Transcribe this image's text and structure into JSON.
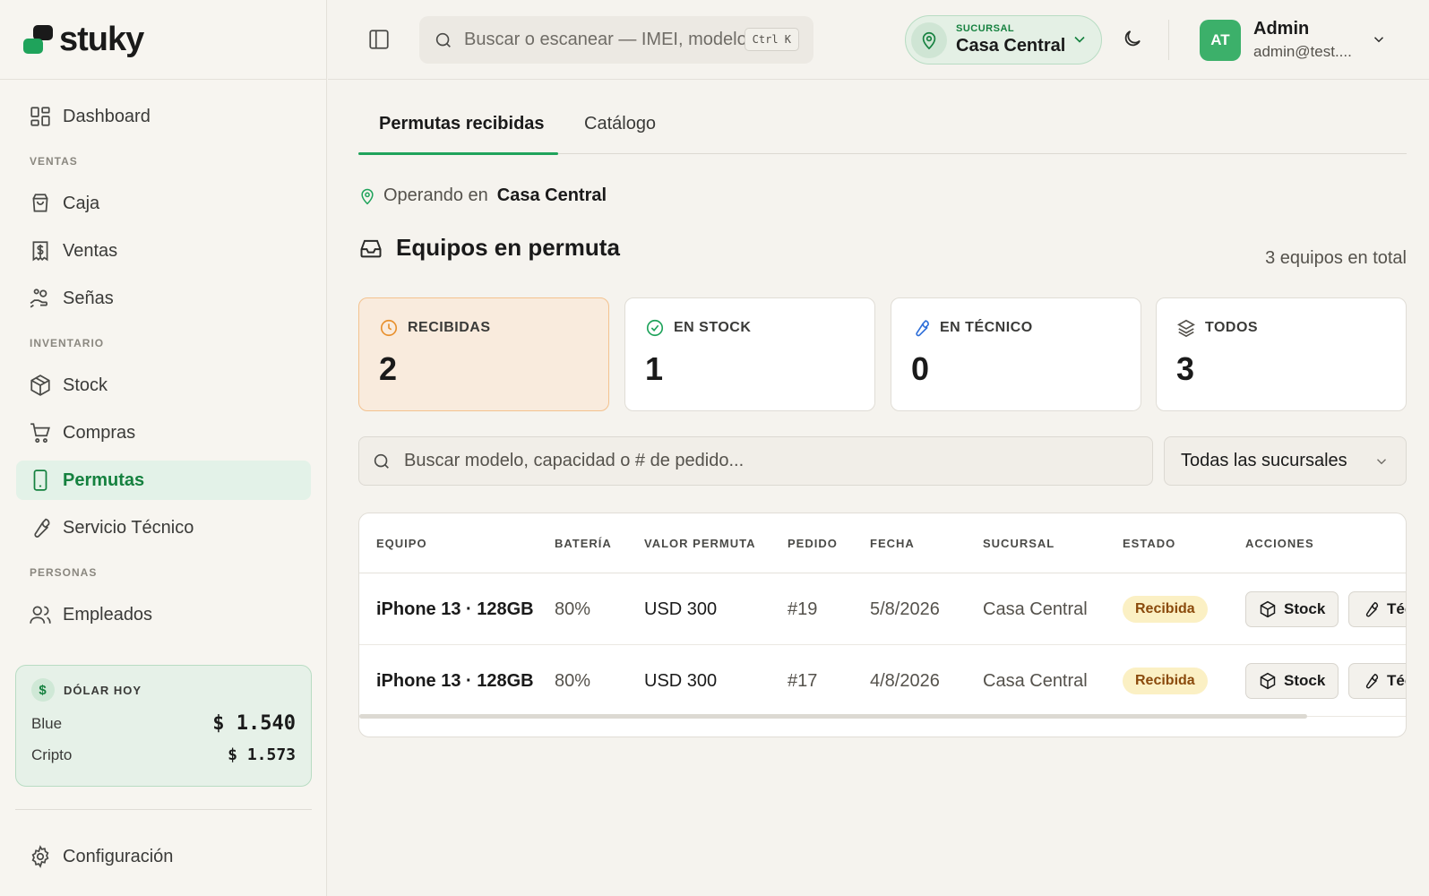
{
  "brand": {
    "name": "stuky"
  },
  "sidebar": {
    "items": [
      {
        "label": "Dashboard",
        "icon": "dashboard-icon"
      },
      {
        "section": "VENTAS"
      },
      {
        "label": "Caja",
        "icon": "shopping-bag-icon"
      },
      {
        "label": "Ventas",
        "icon": "receipt-dollar-icon"
      },
      {
        "label": "Señas",
        "icon": "hand-coins-icon"
      },
      {
        "section": "INVENTARIO"
      },
      {
        "label": "Stock",
        "icon": "package-icon"
      },
      {
        "label": "Compras",
        "icon": "cart-icon"
      },
      {
        "label": "Permutas",
        "icon": "smartphone-icon",
        "active": true
      },
      {
        "label": "Servicio Técnico",
        "icon": "wrench-icon"
      },
      {
        "section": "PERSONAS"
      },
      {
        "label": "Empleados",
        "icon": "users-icon"
      }
    ],
    "dolar": {
      "title": "DÓLAR HOY",
      "rows": [
        {
          "label": "Blue",
          "value": "$ 1.540"
        },
        {
          "label": "Cripto",
          "value": "$ 1.573"
        }
      ]
    },
    "config_label": "Configuración"
  },
  "header": {
    "search_placeholder": "Buscar o escanear — IMEI, modelo, # de pedido",
    "shortcut": "Ctrl K",
    "sucursal_label": "SUCURSAL",
    "sucursal_value": "Casa Central",
    "user": {
      "initials": "AT",
      "name": "Admin",
      "email": "admin@test...."
    }
  },
  "main": {
    "tabs": [
      {
        "label": "Permutas recibidas",
        "active": true
      },
      {
        "label": "Catálogo"
      }
    ],
    "operando_prefix": "Operando en",
    "operando_value": "Casa Central",
    "section_title": "Equipos en permuta",
    "total_text": "3 equipos en total",
    "cards": [
      {
        "label": "RECIBIDAS",
        "value": "2",
        "icon": "clock-icon",
        "color": "#e8912f"
      },
      {
        "label": "EN STOCK",
        "value": "1",
        "icon": "check-circle-icon",
        "color": "#1fa35b"
      },
      {
        "label": "EN TÉCNICO",
        "value": "0",
        "icon": "wrench-icon",
        "color": "#2f6fd9"
      },
      {
        "label": "TODOS",
        "value": "3",
        "icon": "layers-icon",
        "color": "#55524c"
      }
    ],
    "filter_placeholder": "Buscar modelo, capacidad o # de pedido...",
    "filter_select": "Todas las sucursales",
    "table": {
      "columns": [
        "EQUIPO",
        "BATERÍA",
        "VALOR PERMUTA",
        "PEDIDO",
        "FECHA",
        "SUCURSAL",
        "ESTADO",
        "ACCIONES"
      ],
      "rows": [
        {
          "equipo": "iPhone 13 · 128GB",
          "bateria": "80%",
          "valor": "USD 300",
          "pedido": "#19",
          "fecha": "5/8/2026",
          "sucursal": "Casa Central",
          "estado": "Recibida",
          "btn_stock": "Stock",
          "btn_tecnico": "Técnico"
        },
        {
          "equipo": "iPhone 13 · 128GB",
          "bateria": "80%",
          "valor": "USD 300",
          "pedido": "#17",
          "fecha": "4/8/2026",
          "sucursal": "Casa Central",
          "estado": "Recibida",
          "btn_stock": "Stock",
          "btn_tecnico": "Técnico"
        }
      ]
    }
  }
}
